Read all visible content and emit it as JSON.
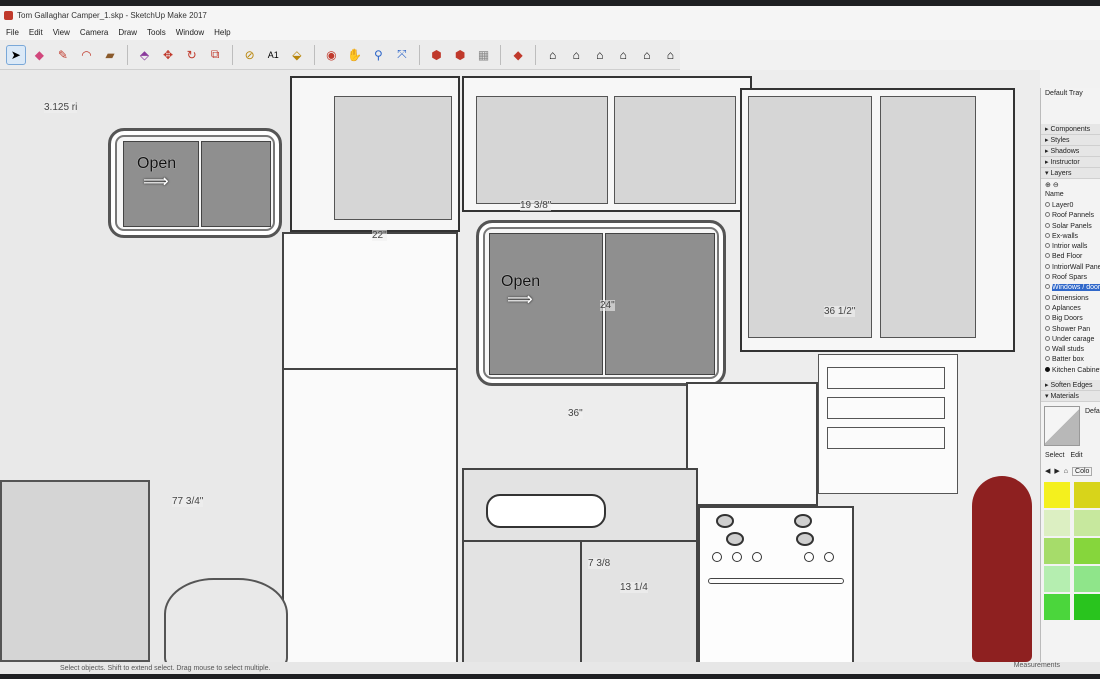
{
  "window": {
    "title": "Tom Gallaghar Camper_1.skp - SketchUp Make 2017"
  },
  "menu": [
    "File",
    "Edit",
    "View",
    "Camera",
    "Draw",
    "Tools",
    "Window",
    "Help"
  ],
  "toolbar": {
    "icons": [
      "select-icon",
      "eraser-icon",
      "pencil-icon",
      "arc-icon",
      "rectangle-icon",
      "push-pull-icon",
      "move-icon",
      "rotate-icon",
      "scale-icon",
      "offset-icon",
      "tape-measure-icon",
      "text-icon",
      "paint-bucket-icon",
      "orbit-icon",
      "pan-icon",
      "zoom-icon",
      "zoom-extents-icon",
      "warehouse-icon",
      "share-model-icon",
      "extension-icon",
      "ruby-icon",
      "iso-view-icon",
      "top-view-icon",
      "front-view-icon",
      "right-view-icon",
      "back-view-icon",
      "left-view-icon"
    ]
  },
  "viewport": {
    "windows": [
      {
        "label": "Open",
        "arrow": "⟹"
      },
      {
        "label": "Open",
        "arrow": "⟹"
      }
    ],
    "dimensions": [
      "3.125 ri",
      "22\"",
      "19 3/8\"",
      "24\"",
      "36 1/2\"",
      "36\"",
      "77 3/4\"",
      "7 3/8",
      "13 1/4"
    ]
  },
  "tray": {
    "title": "Default Tray",
    "sections": [
      "Components",
      "Styles",
      "Shadows",
      "Instructor",
      "Layers"
    ],
    "layers_header": "Name",
    "layers": [
      {
        "name": "Layer0",
        "active": false
      },
      {
        "name": "Roof Pannels",
        "active": false
      },
      {
        "name": "Solar Panels",
        "active": false
      },
      {
        "name": "Ex-walls",
        "active": false
      },
      {
        "name": "Intrior walls",
        "active": false
      },
      {
        "name": "Bed Floor",
        "active": false
      },
      {
        "name": "IntriorWall Panel",
        "active": false
      },
      {
        "name": "Roof Spars",
        "active": false
      },
      {
        "name": "Windows / doors",
        "active": false,
        "selected": true
      },
      {
        "name": "Dimensions",
        "active": false
      },
      {
        "name": "Aplances",
        "active": false
      },
      {
        "name": "Big Doors",
        "active": false
      },
      {
        "name": "Shower Pan",
        "active": false
      },
      {
        "name": "Under carage",
        "active": false
      },
      {
        "name": "Wall studs",
        "active": false
      },
      {
        "name": "Batter box",
        "active": false
      },
      {
        "name": "Kitchen Cabinet",
        "active": true
      }
    ],
    "sections2": [
      "Soften Edges",
      "Materials"
    ],
    "materials": {
      "tabs": [
        "Select",
        "Edit"
      ],
      "default_label": "Defa",
      "colors_label": "Colo",
      "swatches": [
        "#f4f01e",
        "#d8d41a",
        "#dcefc2",
        "#c7e89e",
        "#a6dc6a",
        "#86d63c",
        "#b5eeb0",
        "#8fe58a",
        "#4bd63c",
        "#29c41e"
      ]
    }
  },
  "status": {
    "text": "Select objects. Shift to extend select. Drag mouse to select multiple.",
    "measurements_label": "Measurements"
  },
  "colors": {
    "accent": "#2f67c9",
    "seat": "#8e2020"
  }
}
